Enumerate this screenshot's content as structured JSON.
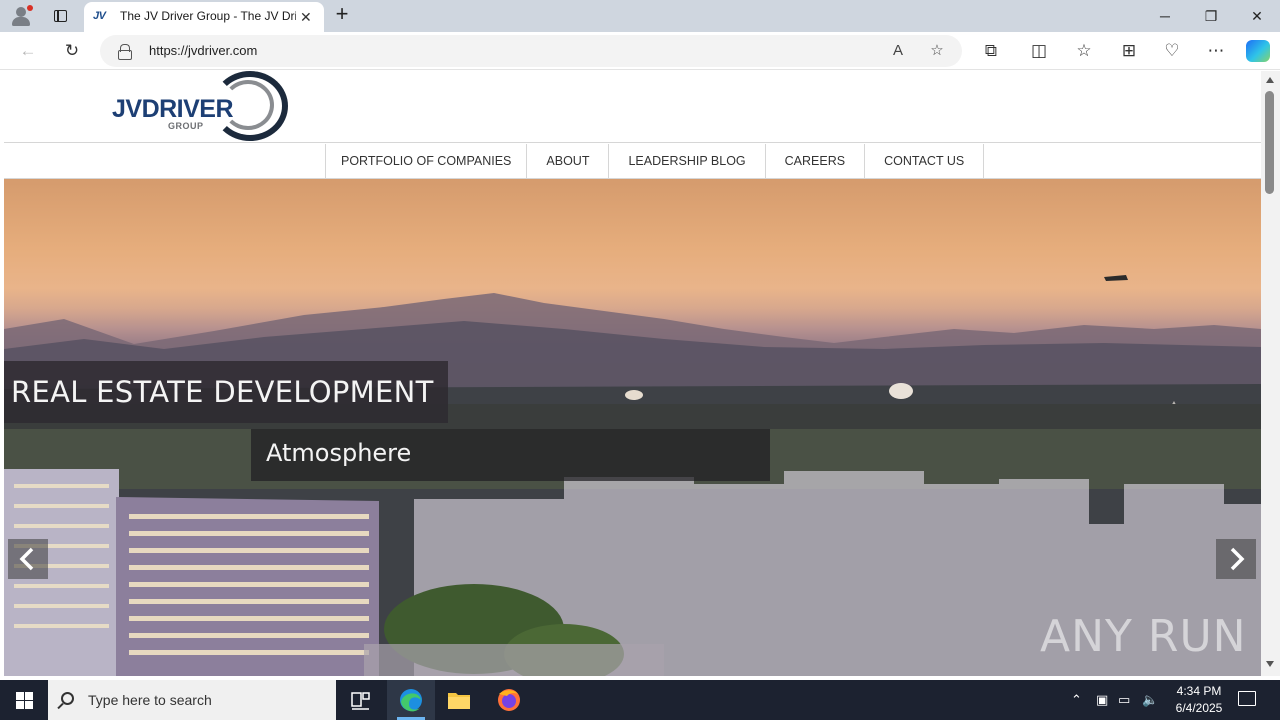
{
  "browser": {
    "tab_title": "The JV Driver Group - The JV Driver Group",
    "tab_favicon": "JV",
    "url": "https://jvdriver.com",
    "new_tab_label": "+",
    "window_controls": {
      "minimize": "─",
      "restore": "❐",
      "close": "✕"
    }
  },
  "site": {
    "logo_text": "JVDRIVER",
    "logo_subtext": "GROUP",
    "nav": [
      "PORTFOLIO OF COMPANIES",
      "ABOUT",
      "LEADERSHIP BLOG",
      "CAREERS",
      "CONTACT US"
    ],
    "hero": {
      "heading": "REAL ESTATE DEVELOPMENT",
      "subheading": "Atmosphere"
    }
  },
  "watermark": "ANY RUN",
  "taskbar": {
    "search_placeholder": "Type here to search",
    "time": "4:34 PM",
    "date": "6/4/2025"
  }
}
